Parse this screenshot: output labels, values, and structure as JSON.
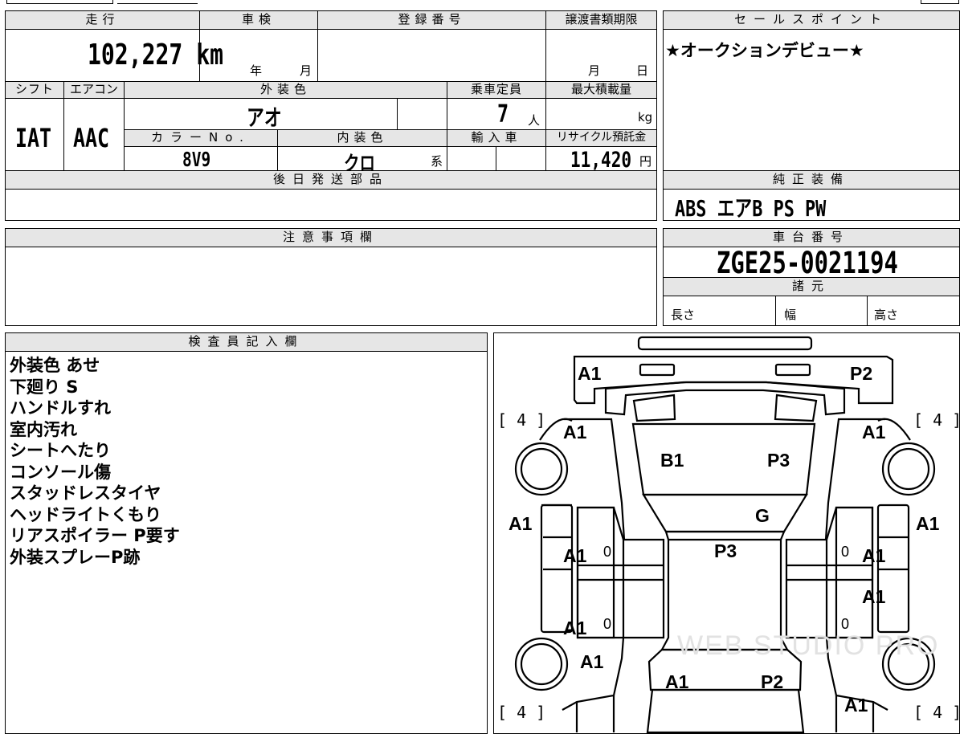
{
  "top_fields": {
    "mileage_label": "走行",
    "mileage_value": "102,227 km",
    "shaken_label": "車検",
    "shaken_year": "年",
    "shaken_month": "月",
    "reg_label": "登録番号",
    "transfer_label": "譲渡書類期限",
    "transfer_month": "月",
    "transfer_day": "日",
    "shift_label": "シフト",
    "shift_value": "IAT",
    "ac_label": "エアコン",
    "ac_value": "AAC",
    "ext_color_label": "外装色",
    "ext_color_value": "アオ",
    "capacity_label": "乗車定員",
    "capacity_value": "7",
    "capacity_unit": "人",
    "max_load_label": "最大積載量",
    "max_load_unit": "kg",
    "color_no_label": "カラーNo.",
    "color_no_value": "8V9",
    "int_color_label": "内装色",
    "int_color_value": "クロ",
    "int_color_suffix": "系",
    "import_label": "輸入車",
    "recycle_label": "リサイクル預託金",
    "recycle_value": "11,420",
    "recycle_unit": "円",
    "later_parts_label": "後日発送部品"
  },
  "sales_point": {
    "label": "セールスポイント",
    "text": "★オークションデビュー★"
  },
  "standard_equipment": {
    "label": "純正装備",
    "text": "ABS エアB PS PW"
  },
  "notes": {
    "label": "注意事項欄"
  },
  "chassis": {
    "label": "車台番号",
    "value": "ZGE25-0021194",
    "spec_label": "諸元",
    "length_label": "長さ",
    "width_label": "幅",
    "height_label": "高さ"
  },
  "inspector": {
    "label": "検査員記入欄",
    "lines": [
      "外装色 あせ",
      "下廻り S",
      "ハンドルすれ",
      "室内汚れ",
      "シートへたり",
      "コンソール傷",
      "スタッドレスタイヤ",
      "ヘッドライトくもり",
      "リアスポイラー P要す",
      "外装スプレーP跡"
    ]
  },
  "diagram": {
    "tire_fl": "[ 4 ]",
    "tire_fr": "[ 4 ]",
    "tire_rl": "[ 4 ]",
    "tire_rr": "[ 4 ]",
    "hood_left": "A1",
    "hood_right": "P2",
    "front_fender_left": "A1",
    "front_fender_right": "A1",
    "windshield_left": "B1",
    "windshield_right": "P3",
    "roof_glass": "G",
    "roof": "P3",
    "pillar_left": "A1",
    "pillar_right": "A1",
    "front_door_left": "A1",
    "front_door_right": "A1",
    "rear_door_left": "A1",
    "rear_door_right": "A1",
    "door_zero_1": "0",
    "door_zero_2": "0",
    "door_zero_3": "0",
    "door_zero_4": "0",
    "rear_fender_left": "A1",
    "rear_fender_right": "A1",
    "tailgate_left": "A1",
    "tailgate_right": "P2",
    "watermark": "WEB STUDIO PRO"
  }
}
